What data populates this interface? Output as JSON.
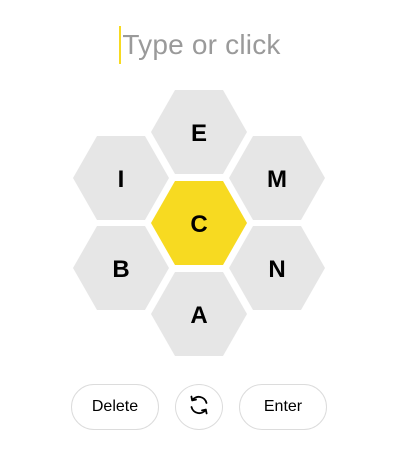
{
  "input": {
    "placeholder": "Type or click",
    "value": ""
  },
  "hive": {
    "center_letter": "C",
    "letters": {
      "top": "E",
      "upper_left": "I",
      "upper_right": "M",
      "lower_left": "B",
      "lower_right": "N",
      "bottom": "A"
    }
  },
  "controls": {
    "delete_label": "Delete",
    "shuffle_icon": "shuffle-arrows-icon",
    "enter_label": "Enter"
  },
  "colors": {
    "center": "#f7da21",
    "outer": "#e6e6e6",
    "caret": "#f7da21"
  }
}
